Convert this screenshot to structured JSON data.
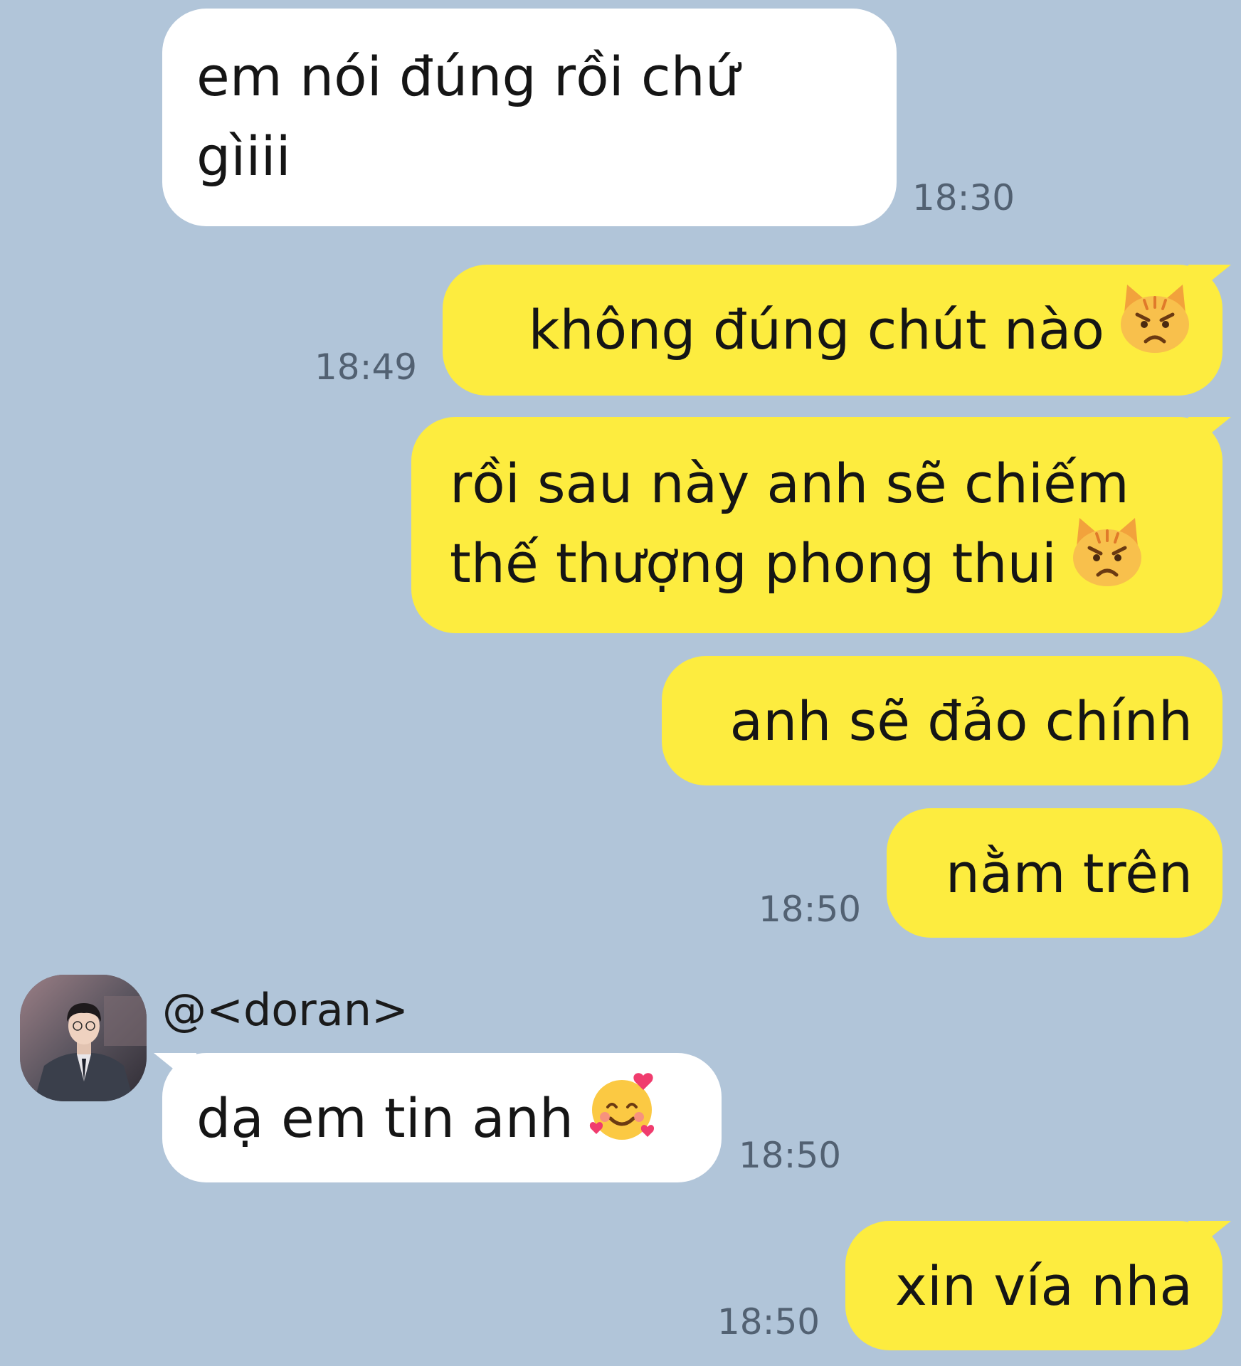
{
  "chat": {
    "colors": {
      "background": "#b1c5d9",
      "incoming_bubble": "#ffffff",
      "outgoing_bubble": "#fdec3f",
      "timestamp": "#526172"
    },
    "messages": {
      "m1": {
        "direction": "incoming",
        "lines": [
          "em nói đúng rồi chứ",
          "gìiii"
        ],
        "time": "18:30"
      },
      "m2": {
        "direction": "outgoing",
        "text": "không đúng chút nào",
        "emoji": "angry-cat-emoji",
        "time": "18:49"
      },
      "m3": {
        "direction": "outgoing",
        "lines": [
          "rồi sau này anh sẽ chiếm",
          "thế thượng phong thui"
        ],
        "emoji": "angry-cat-emoji"
      },
      "m4": {
        "direction": "outgoing",
        "text": "anh sẽ đảo chính"
      },
      "m5": {
        "direction": "outgoing",
        "text": "nằm trên",
        "time": "18:50"
      },
      "m6": {
        "direction": "incoming",
        "sender": "@<doran>",
        "text": "dạ em tin anh",
        "emoji": "smiling-face-with-hearts-emoji",
        "time": "18:50"
      },
      "m7": {
        "direction": "outgoing",
        "text": "xin vía nha",
        "time": "18:50"
      }
    }
  }
}
